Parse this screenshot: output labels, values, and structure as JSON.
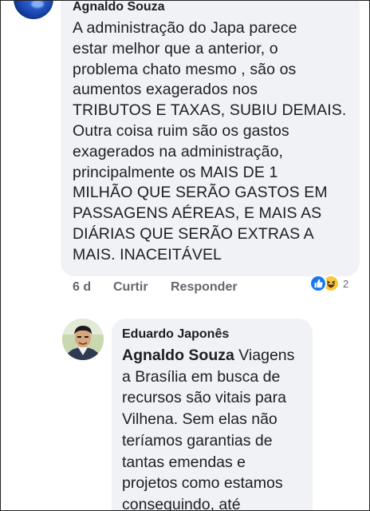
{
  "comment": {
    "author": "Agnaldo Souza",
    "text_lines": [
      "A administração do Japa parece",
      "estar melhor que a anterior, o",
      "problema chato mesmo , são os",
      "aumentos exagerados nos",
      "TRIBUTOS E TAXAS, SUBIU DEMAIS.",
      "Outra coisa ruim são os gastos",
      "exagerados na administração,",
      "principalmente os MAIS DE 1",
      "MILHÃO QUE SERÃO GASTOS EM",
      "PASSAGENS AÉREAS, E MAIS AS",
      "DIÁRIAS QUE SERÃO EXTRAS A",
      "MAIS. INACEITÁVEL"
    ],
    "time": "6 d",
    "like_label": "Curtir",
    "reply_label": "Responder",
    "reaction_count": "2",
    "reaction_icons": [
      "like-icon",
      "haha-icon"
    ],
    "colors": {
      "like": "#1877f2",
      "haha": "#f7c83c",
      "bubble": "#f0f2f5",
      "muted": "#65676b"
    }
  },
  "reply": {
    "author": "Eduardo Japonês",
    "mention": "Agnaldo Souza",
    "text_lines": [
      " Viagens",
      "a Brasília em busca de",
      "recursos são vitais para",
      "Vilhena. Sem elas não",
      "teríamos garantias de",
      "tantas emendas e",
      "projetos como estamos",
      "conseguindo, até"
    ]
  }
}
